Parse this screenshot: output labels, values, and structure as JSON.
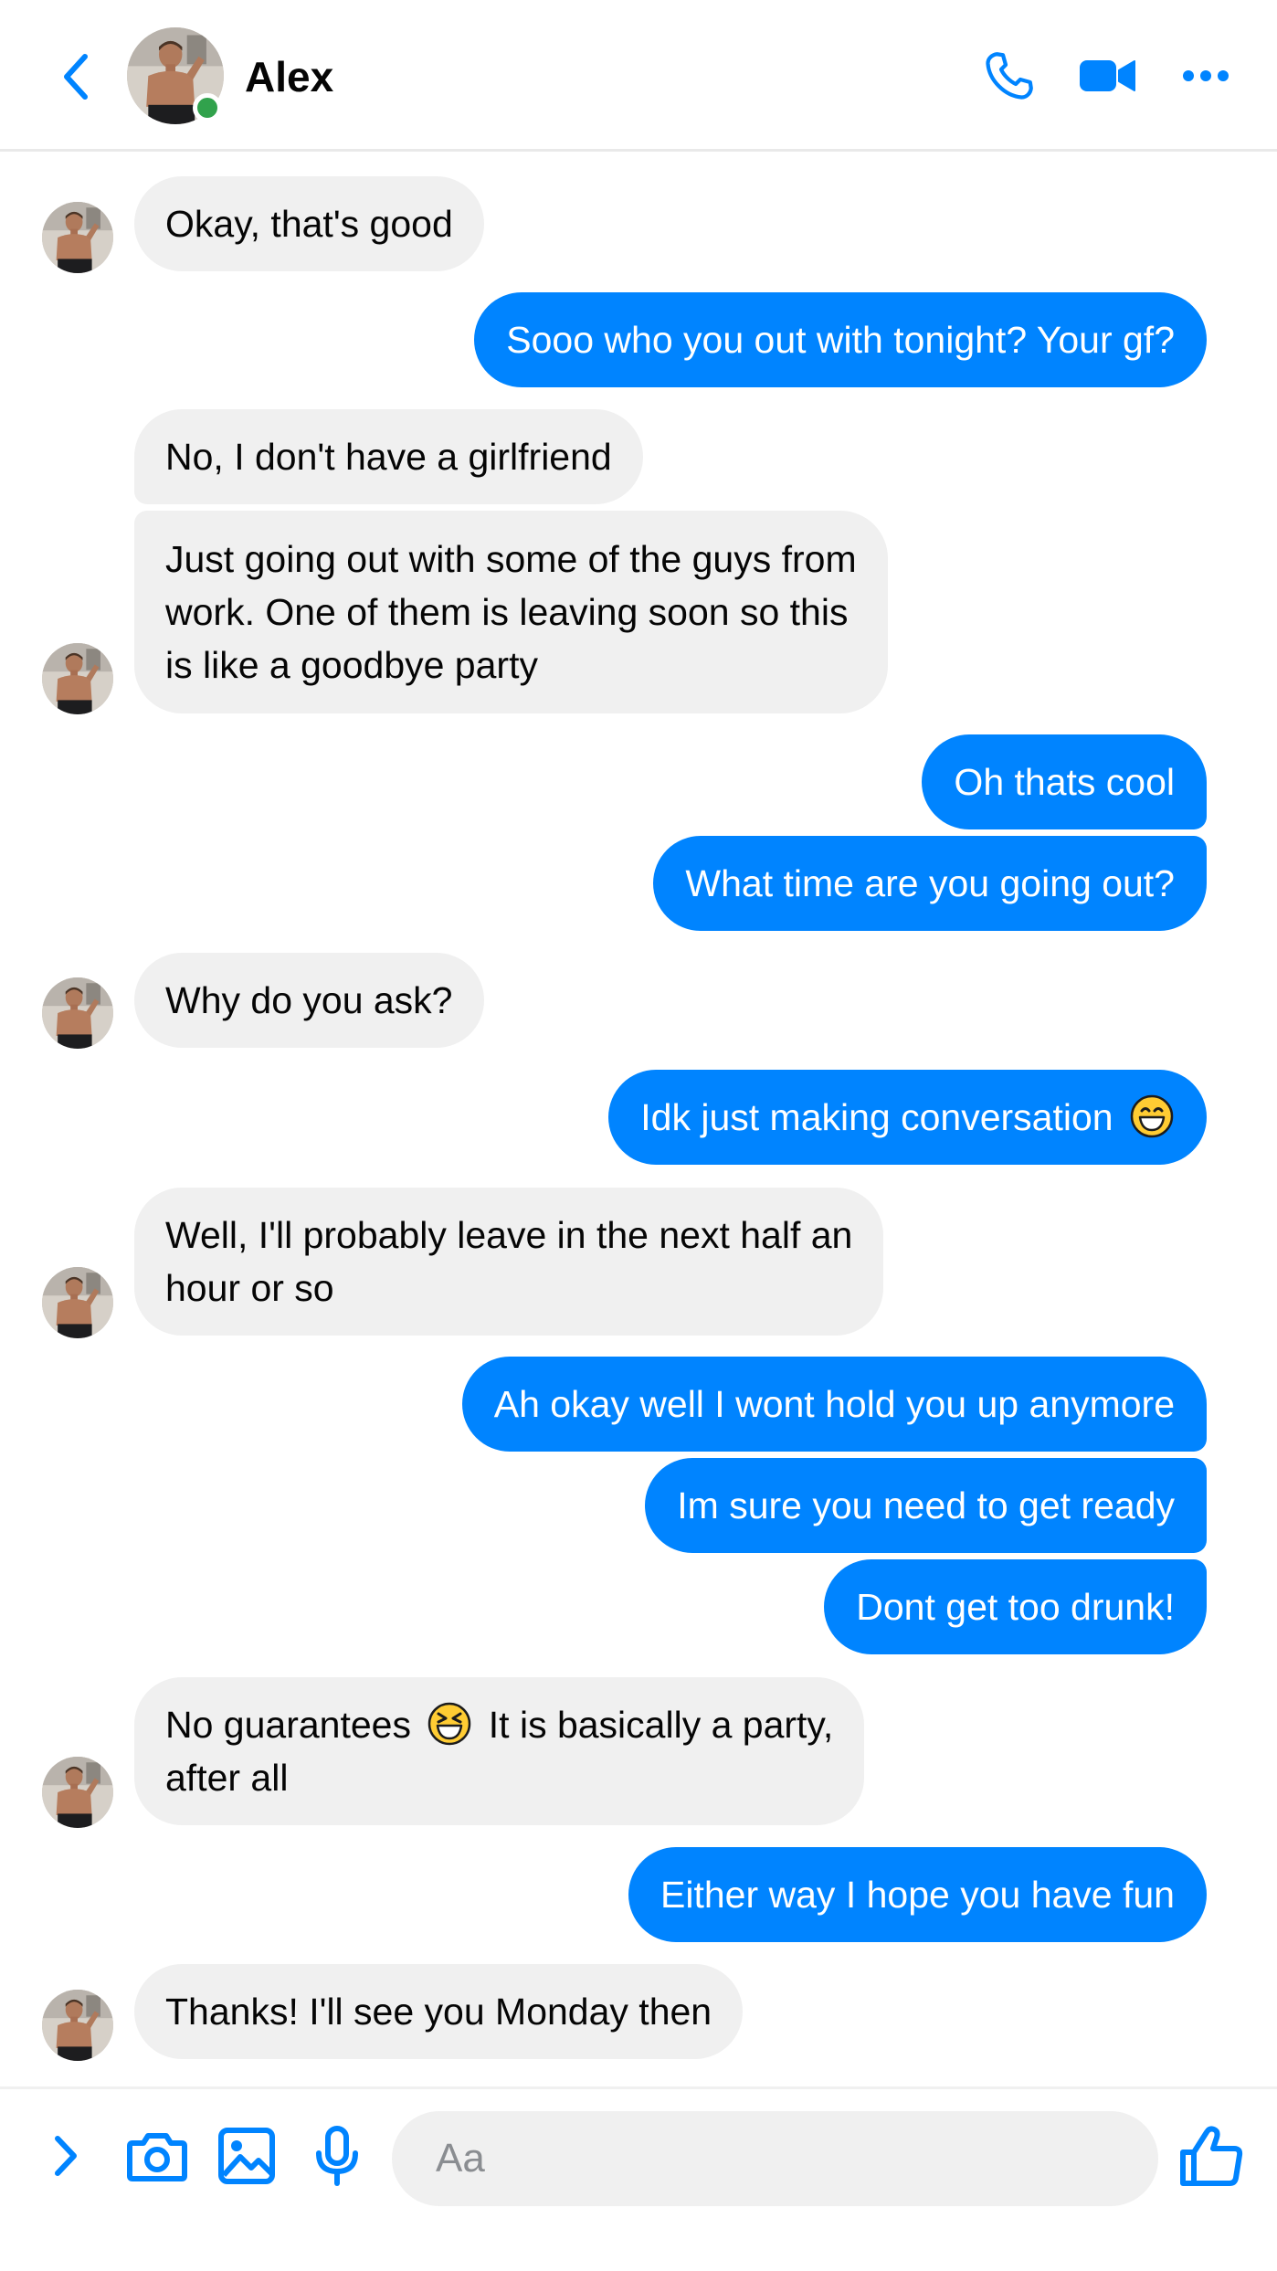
{
  "header": {
    "contact_name": "Alex",
    "online": true,
    "icons": [
      "back-chevron-icon",
      "phone-icon",
      "video-camera-icon",
      "more-options-icon"
    ]
  },
  "messages": [
    {
      "from": "them",
      "text": "Okay, that's good"
    },
    {
      "from": "me",
      "text": "Sooo who you out with tonight? Your gf?"
    },
    {
      "from": "them",
      "text": "No, I don't have a girlfriend"
    },
    {
      "from": "them",
      "lines": [
        "Just going out with some of the guys from",
        "work. One of them is leaving soon so this",
        "is like a goodbye party"
      ]
    },
    {
      "from": "me",
      "text": "Oh thats cool"
    },
    {
      "from": "me",
      "text": "What time are you going out?"
    },
    {
      "from": "them",
      "text": "Why do you ask?"
    },
    {
      "from": "me",
      "text": "Idk just making conversation",
      "emoji": "grinning-face-icon"
    },
    {
      "from": "them",
      "lines": [
        "Well, I'll probably leave in the next half an",
        "hour or so"
      ]
    },
    {
      "from": "me",
      "text": "Ah okay well I wont hold you up anymore"
    },
    {
      "from": "me",
      "text": "Im sure you need to get ready"
    },
    {
      "from": "me",
      "text": "Dont get too drunk!"
    },
    {
      "from": "them",
      "line1_before_emoji": "No guarantees",
      "emoji": "laughing-squinting-face-icon",
      "line1_after_emoji": "It is basically a party,",
      "line2": "after all"
    },
    {
      "from": "me",
      "text": "Either way I hope you have fun"
    },
    {
      "from": "them",
      "text": "Thanks! I'll see you Monday then"
    }
  ],
  "composer": {
    "placeholder": "Aa",
    "icons": [
      "expand-chevron-icon",
      "camera-icon",
      "gallery-icon",
      "microphone-icon",
      "thumbs-up-icon"
    ]
  },
  "colors": {
    "accent": "#0084ff",
    "incoming_bubble": "#f0f0f0",
    "online": "#31a24c"
  }
}
